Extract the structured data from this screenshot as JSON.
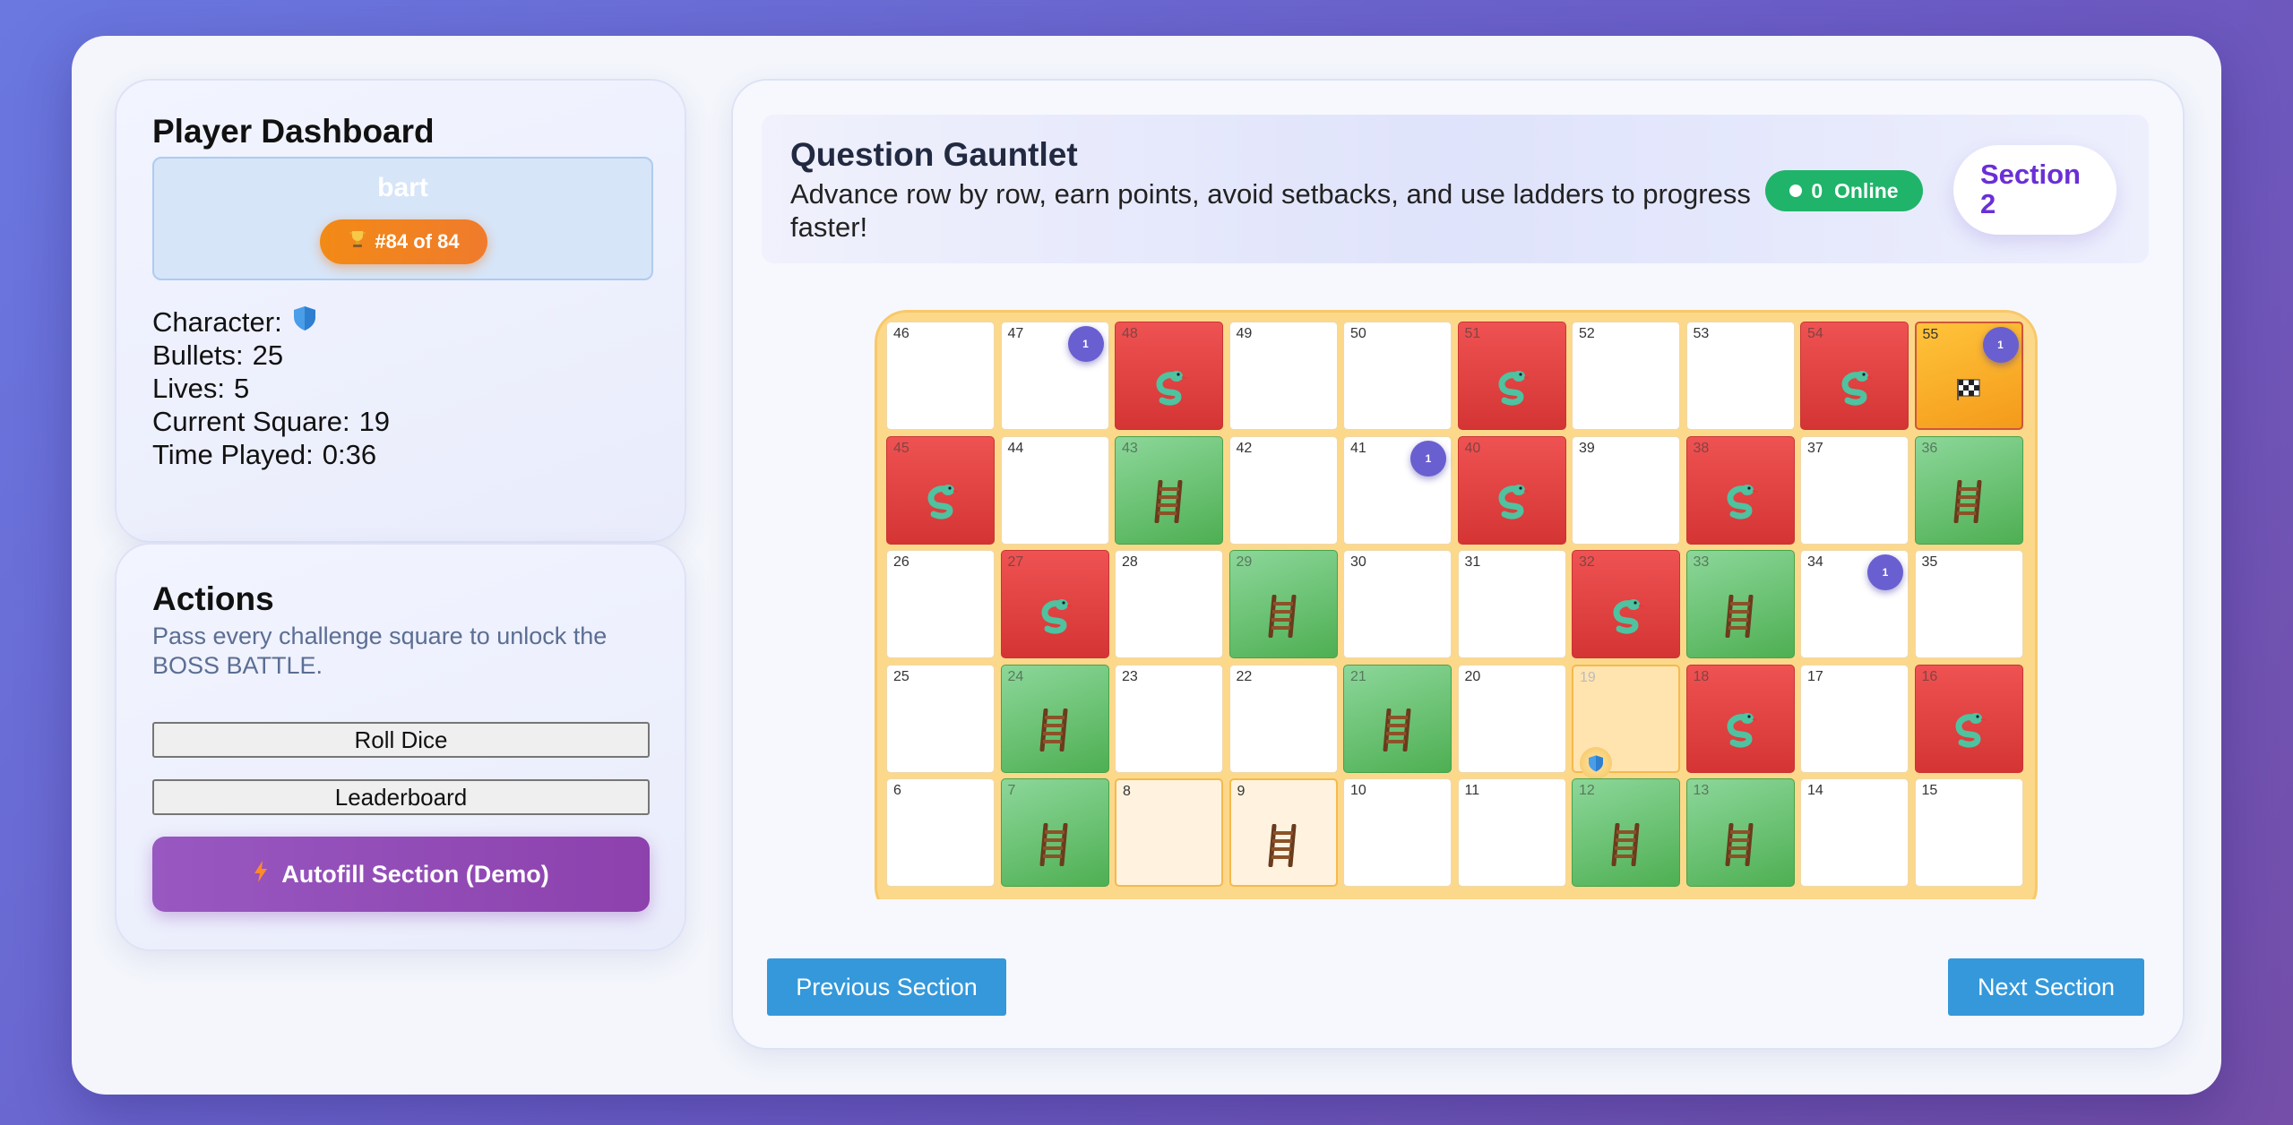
{
  "dashboard": {
    "title": "Player Dashboard",
    "player_name": "bart",
    "rank": "#84 of 84",
    "stats": [
      {
        "label": "Character:",
        "value": "",
        "icon": "shield-icon"
      },
      {
        "label": "Bullets:",
        "value": "25"
      },
      {
        "label": "Lives:",
        "value": "5"
      },
      {
        "label": "Current Square:",
        "value": "19"
      },
      {
        "label": "Time Played:",
        "value": "0:36"
      }
    ]
  },
  "actions": {
    "title": "Actions",
    "description": "Pass every challenge square to unlock the BOSS BATTLE.",
    "roll_dice": "Roll Dice",
    "leaderboard": "Leaderboard",
    "autofill": "Autofill Section (Demo)"
  },
  "header": {
    "title": "Question Gauntlet",
    "subtitle": "Advance row by row, earn points, avoid setbacks, and use ladders to progress faster!",
    "online": "0  Online",
    "section_line1": "Section",
    "section_line2": "2"
  },
  "board": {
    "current_square": 19,
    "rows": [
      [
        {
          "n": "46",
          "t": ""
        },
        {
          "n": "47",
          "t": "",
          "c": "1"
        },
        {
          "n": "48",
          "t": "snake"
        },
        {
          "n": "49",
          "t": ""
        },
        {
          "n": "50",
          "t": ""
        },
        {
          "n": "51",
          "t": "snake"
        },
        {
          "n": "52",
          "t": ""
        },
        {
          "n": "53",
          "t": ""
        },
        {
          "n": "54",
          "t": "snake"
        },
        {
          "n": "55",
          "t": "goal",
          "c": "1"
        }
      ],
      [
        {
          "n": "45",
          "t": "snake"
        },
        {
          "n": "44",
          "t": ""
        },
        {
          "n": "43",
          "t": "ladder"
        },
        {
          "n": "42",
          "t": ""
        },
        {
          "n": "41",
          "t": "",
          "c": "1"
        },
        {
          "n": "40",
          "t": "snake"
        },
        {
          "n": "39",
          "t": ""
        },
        {
          "n": "38",
          "t": "snake"
        },
        {
          "n": "37",
          "t": ""
        },
        {
          "n": "36",
          "t": "ladder"
        }
      ],
      [
        {
          "n": "26",
          "t": ""
        },
        {
          "n": "27",
          "t": "snake"
        },
        {
          "n": "28",
          "t": ""
        },
        {
          "n": "29",
          "t": "ladder"
        },
        {
          "n": "30",
          "t": ""
        },
        {
          "n": "31",
          "t": ""
        },
        {
          "n": "32",
          "t": "snake"
        },
        {
          "n": "33",
          "t": "ladder"
        },
        {
          "n": "34",
          "t": "",
          "c": "1"
        },
        {
          "n": "35",
          "t": ""
        }
      ],
      [
        {
          "n": "25",
          "t": ""
        },
        {
          "n": "24",
          "t": "ladder"
        },
        {
          "n": "23",
          "t": ""
        },
        {
          "n": "22",
          "t": ""
        },
        {
          "n": "21",
          "t": "ladder"
        },
        {
          "n": "20",
          "t": ""
        },
        {
          "n": "19",
          "t": "current"
        },
        {
          "n": "18",
          "t": "snake"
        },
        {
          "n": "17",
          "t": ""
        },
        {
          "n": "16",
          "t": "snake"
        }
      ],
      [
        {
          "n": "6",
          "t": ""
        },
        {
          "n": "7",
          "t": "ladder"
        },
        {
          "n": "8",
          "t": "visited"
        },
        {
          "n": "9",
          "t": "visited-ladder"
        },
        {
          "n": "10",
          "t": ""
        },
        {
          "n": "11",
          "t": ""
        },
        {
          "n": "12",
          "t": "ladder"
        },
        {
          "n": "13",
          "t": "ladder"
        },
        {
          "n": "14",
          "t": ""
        },
        {
          "n": "15",
          "t": ""
        }
      ]
    ]
  },
  "nav": {
    "previous": "Previous Section",
    "next": "Next Section"
  },
  "colors": {
    "snake": "#e04444",
    "ladder": "#5cb85c",
    "board": "#fcd88b",
    "online": "#1fb469",
    "nav": "#3498db",
    "autofill": "#9250b8"
  }
}
